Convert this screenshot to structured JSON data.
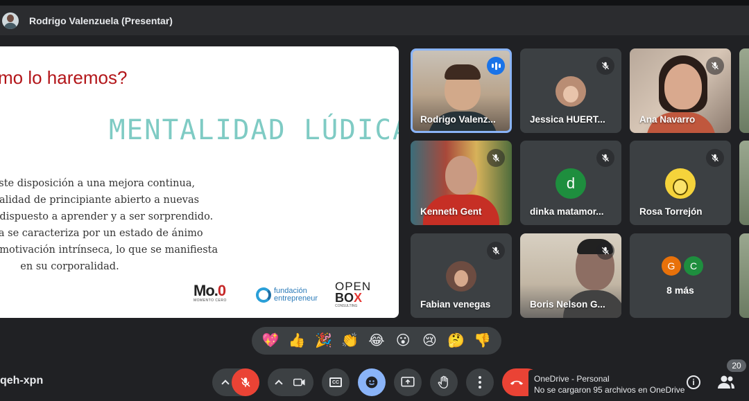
{
  "presenter": {
    "name": "Rodrigo Valenzuela (Presentar)"
  },
  "slide": {
    "heading": "mo lo haremos?",
    "title": "MENTALIDAD LÚDICA",
    "body": [
      "Existe disposición a una mejora continua,",
      "na mentalidad de principiante abierto a nuevas",
      "iencias, dispuesto a aprender y a ser sorprendido.",
      "la vivencia se caracteriza por un estado de ánimo",
      "vo y una motivación intrínseca, lo que se manifiesta",
      "en su corporalidad."
    ],
    "logos": {
      "mo_main": "Mo.",
      "mo_o": "0",
      "mo_sub": "MOMENTO CERO",
      "fundacion_1": "fundación",
      "fundacion_2": "entrepreneur",
      "openbox_1": "OPEN",
      "openbox_2": "BO",
      "openbox_x": "X",
      "openbox_3": "CONSULTING"
    }
  },
  "participants": [
    {
      "name": "Rodrigo Valenz...",
      "state": "speaking"
    },
    {
      "name": "Jessica HUERT...",
      "state": "muted"
    },
    {
      "name": "Ana Navarro",
      "state": "muted"
    },
    {
      "name": "Kenneth Gent",
      "state": "muted"
    },
    {
      "name": "dinka matamor...",
      "state": "muted",
      "initial": "d",
      "color": "#1e8e3e"
    },
    {
      "name": "Rosa Torrejón",
      "state": "muted"
    },
    {
      "name": "Fabian venegas",
      "state": "muted"
    },
    {
      "name": "Boris Nelson G...",
      "state": "muted"
    },
    {
      "name": "8 más",
      "initials": [
        "G",
        "C"
      ],
      "colors": [
        "#e8710a",
        "#1e8e3e"
      ]
    }
  ],
  "reactions": [
    "💖",
    "👍",
    "🎉",
    "👏",
    "😂",
    "😮",
    "😢",
    "🤔",
    "👎"
  ],
  "meeting": {
    "code": "qeh-xpn"
  },
  "controls": {
    "mic_state": "off",
    "camera": "camera",
    "captions": "CC",
    "people_count": "20"
  },
  "notification": {
    "title": "OneDrive - Personal",
    "message": "No se cargaron 95 archivos en OneDrive"
  },
  "colors": {
    "accent_blue": "#8ab4f8",
    "end_red": "#ea4335",
    "bar_bg": "#3c4043"
  }
}
